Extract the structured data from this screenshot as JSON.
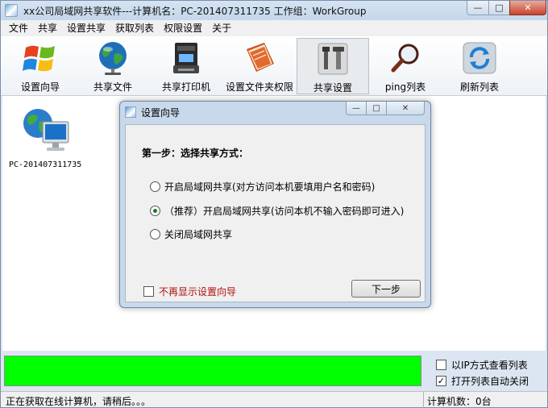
{
  "window": {
    "title": "xx公司局域网共享软件---计算机名：PC-201407311735  工作组：WorkGroup",
    "min_glyph": "—",
    "max_glyph": "□",
    "close_glyph": "✕"
  },
  "menu": [
    "文件",
    "共享",
    "设置共享",
    "获取列表",
    "权限设置",
    "关于"
  ],
  "toolbar": [
    {
      "label": "设置向导",
      "icon": "windows-logo-icon"
    },
    {
      "label": "共享文件",
      "icon": "globe-icon"
    },
    {
      "label": "共享打印机",
      "icon": "printer-icon"
    },
    {
      "label": "设置文件夹权限",
      "icon": "book-icon"
    },
    {
      "label": "共享设置",
      "icon": "tools-icon"
    },
    {
      "label": "ping列表",
      "icon": "magnifier-icon"
    },
    {
      "label": "刷新列表",
      "icon": "refresh-icon"
    }
  ],
  "computers": [
    {
      "name": "PC-201407311735"
    }
  ],
  "options": {
    "view_by_ip": "以IP方式查看列表",
    "auto_close": "打开列表自动关闭"
  },
  "status": {
    "left": "正在获取在线计算机，请稍后。。。",
    "right": "计算机数：0台"
  },
  "dialog": {
    "title": "设置向导",
    "step": "第一步：选择共享方式：",
    "options": [
      "开启局域网共享(对方访问本机要填用户名和密码)",
      "（推荐）开启局域网共享(访问本机不输入密码即可进入)",
      "关闭局域网共享"
    ],
    "no_show": "不再显示设置向导",
    "next": "下一步"
  }
}
